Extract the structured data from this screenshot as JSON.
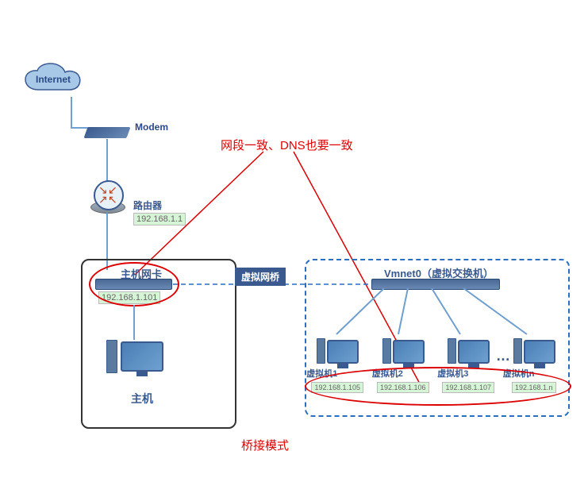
{
  "annotation": {
    "title": "网段一致、DNS也要一致"
  },
  "internet": {
    "label": "Internet"
  },
  "modem": {
    "label": "Modem"
  },
  "router": {
    "label": "路由器",
    "ip": "192.168.1.1"
  },
  "bridge": {
    "label": "虚拟网桥"
  },
  "vswitch": {
    "label": "Vmnet0（虚拟交换机）"
  },
  "host": {
    "nic_label": "主机网卡",
    "nic_ip": "192.168.1.101",
    "label": "主机"
  },
  "vms": [
    {
      "label": "虚拟机1",
      "ip": "192.168.1.105"
    },
    {
      "label": "虚拟机2",
      "ip": "192.168.1.106"
    },
    {
      "label": "虚拟机3",
      "ip": "192.168.1.107"
    },
    {
      "label": "虚拟机n",
      "ip": "192.168.1.n"
    }
  ],
  "bottom_caption": "桥接模式",
  "ellipsis": "…"
}
